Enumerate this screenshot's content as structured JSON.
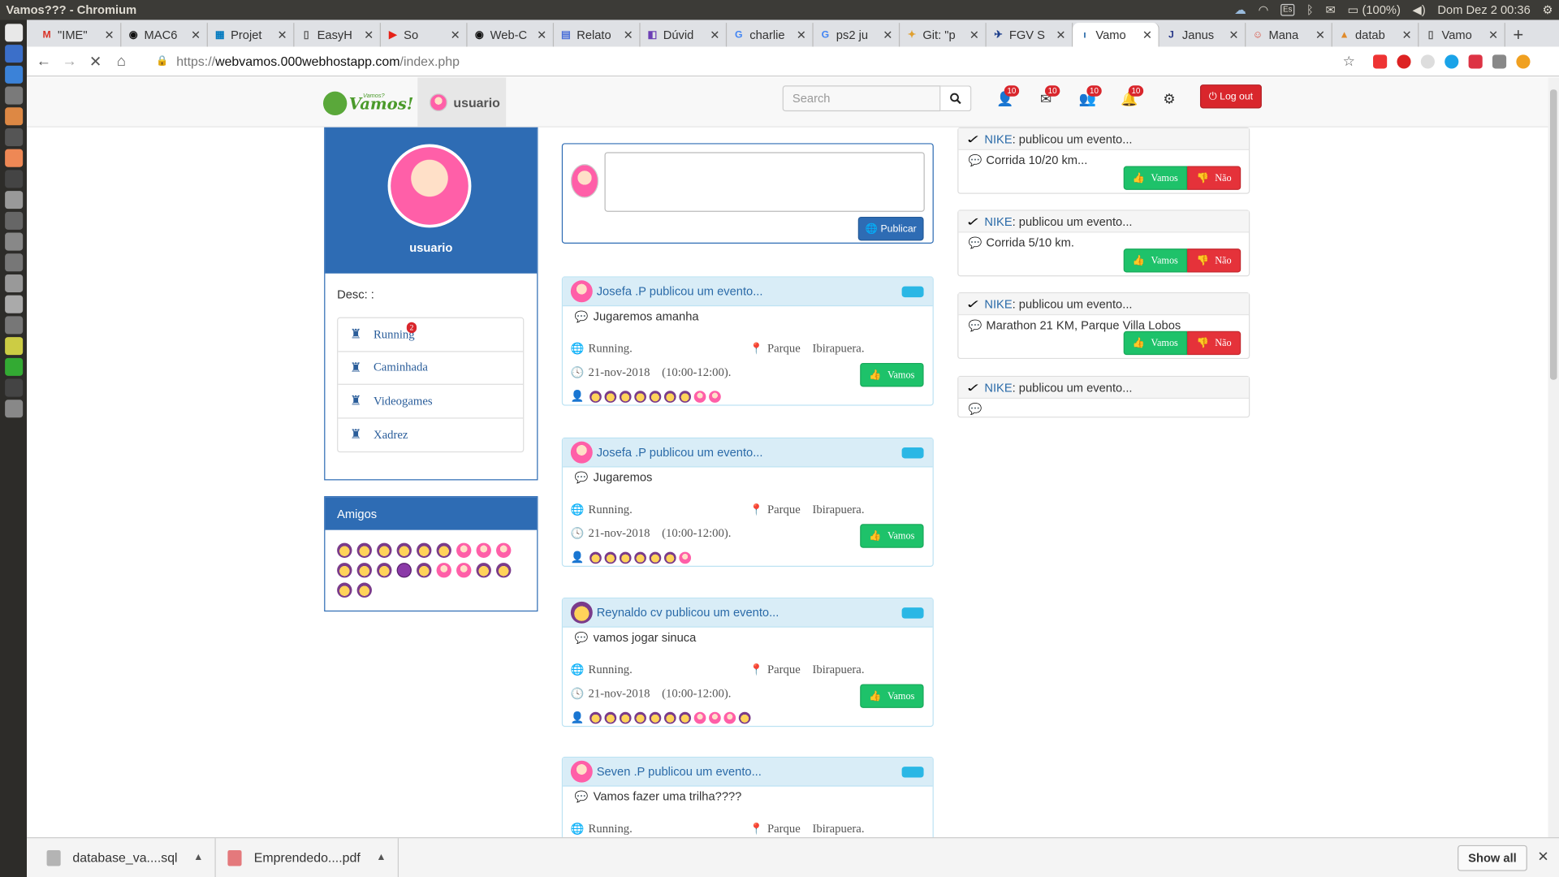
{
  "window": {
    "title": "Vamos??? - Chromium"
  },
  "system_tray": {
    "keyboard": "Es",
    "battery": "(100%)",
    "clock": "Dom Dez  2 00:36"
  },
  "tabs": [
    {
      "label": "\"IME\"",
      "favicon": "M",
      "color": "#d93025"
    },
    {
      "label": "MAC6",
      "favicon": "◉",
      "color": "#111"
    },
    {
      "label": "Projet",
      "favicon": "▦",
      "color": "#0079bf"
    },
    {
      "label": "EasyH",
      "favicon": "▯",
      "color": "#555"
    },
    {
      "label": "So",
      "favicon": "▶",
      "color": "#e62117"
    },
    {
      "label": "Web-C",
      "favicon": "◉",
      "color": "#111"
    },
    {
      "label": "Relato",
      "favicon": "▤",
      "color": "#4a6fd8"
    },
    {
      "label": "Dúvid",
      "favicon": "◧",
      "color": "#6c3fb5"
    },
    {
      "label": "charlie",
      "favicon": "G",
      "color": "#4285f4"
    },
    {
      "label": "ps2 ju",
      "favicon": "G",
      "color": "#4285f4"
    },
    {
      "label": "Git: \"p",
      "favicon": "✦",
      "color": "#e0a030"
    },
    {
      "label": "FGV S",
      "favicon": "✈",
      "color": "#1a3c8a"
    },
    {
      "label": "Vamo",
      "favicon": "ı",
      "color": "#2a6aa8"
    },
    {
      "label": "Janus",
      "favicon": "J",
      "color": "#2a3a8a"
    },
    {
      "label": "Mana",
      "favicon": "☺",
      "color": "#d94a3a"
    },
    {
      "label": "datab",
      "favicon": "▲",
      "color": "#e08a2a"
    },
    {
      "label": "Vamo",
      "favicon": "▯",
      "color": "#555"
    }
  ],
  "active_tab_index": 12,
  "address": {
    "scheme": "https://",
    "host": "webvamos.000webhostapp.com",
    "path": "/index.php"
  },
  "site": {
    "logo_small": "Vamos?",
    "logo_text": "Vamos!",
    "username": "usuario",
    "search_placeholder": "Search",
    "notification_badges": [
      "10",
      "10",
      "10",
      "10"
    ],
    "logout_label": "Log out"
  },
  "profile": {
    "name": "usuario",
    "desc": "Desc: :",
    "hobbies": [
      {
        "label": "Running",
        "badge": "2"
      },
      {
        "label": "Caminhada",
        "badge": ""
      },
      {
        "label": "Videogames",
        "badge": ""
      },
      {
        "label": "Xadrez",
        "badge": ""
      }
    ]
  },
  "friends": {
    "title": "Amigos",
    "avatars": [
      "yellow",
      "yellow",
      "yellow",
      "yellow",
      "yellow",
      "yellow",
      "pink",
      "pink",
      "pink",
      "yellow",
      "yellow",
      "yellow",
      "purple",
      "yellow",
      "pink",
      "pink",
      "yellow",
      "yellow",
      "yellow",
      "yellow"
    ]
  },
  "composer": {
    "publish_label": "Publicar"
  },
  "posts": [
    {
      "author": "Josefa .P publicou um evento...",
      "author_avatar": "pink",
      "text": "Jugaremos amanha",
      "sport": "Running.",
      "place": "Parque    Ibirapuera.",
      "datetime": "21-nov-2018    (10:00-12:00).",
      "button": "Vamos",
      "attendees": [
        "yellow",
        "yellow",
        "yellow",
        "yellow",
        "yellow",
        "yellow",
        "yellow",
        "pink",
        "pink"
      ]
    },
    {
      "author": "Josefa .P publicou um evento...",
      "author_avatar": "pink",
      "text": "Jugaremos",
      "sport": "Running.",
      "place": "Parque    Ibirapuera.",
      "datetime": "21-nov-2018    (10:00-12:00).",
      "button": "Vamos",
      "attendees": [
        "yellow",
        "yellow",
        "yellow",
        "yellow",
        "yellow",
        "yellow",
        "pink"
      ]
    },
    {
      "author": "Reynaldo cv publicou um evento...",
      "author_avatar": "yellow",
      "text": "vamos jogar sinuca",
      "sport": "Running.",
      "place": "Parque    Ibirapuera.",
      "datetime": "21-nov-2018    (10:00-12:00).",
      "button": "Vamos",
      "attendees": [
        "yellow",
        "yellow",
        "yellow",
        "yellow",
        "yellow",
        "yellow",
        "yellow",
        "pink",
        "pink",
        "pink",
        "yellow"
      ]
    },
    {
      "author": "Seven .P publicou um evento...",
      "author_avatar": "pink",
      "text": "Vamos fazer uma trilha????",
      "sport": "Running.",
      "place": "Parque    Ibirapuera.",
      "datetime": "",
      "button": "",
      "attendees": []
    }
  ],
  "sponsored": [
    {
      "brand": "NIKE",
      "headline": " : publicou um evento...",
      "text": "Corrida 10/20 km...",
      "yes": "Vamos",
      "no": "Não"
    },
    {
      "brand": "NIKE",
      "headline": " : publicou um evento...",
      "text": "Corrida 5/10 km.",
      "yes": "Vamos",
      "no": "Não"
    },
    {
      "brand": "NIKE",
      "headline": " : publicou um evento...",
      "text": "Marathon 21 KM, Parque Villa Lobos",
      "yes": "Vamos",
      "no": "Não"
    },
    {
      "brand": "NIKE",
      "headline": " : publicou um evento...",
      "text": "",
      "yes": "",
      "no": ""
    }
  ],
  "downloads": [
    {
      "name": "database_va....sql",
      "color": "#888"
    },
    {
      "name": "Emprendedo....pdf",
      "color": "#d9262c"
    }
  ],
  "download_bar": {
    "show_all": "Show all"
  },
  "colors": {
    "brand_blue": "#2e6cb4",
    "vamos_green": "#1ec26a",
    "nao_red": "#e5323a",
    "logout_red": "#d9262c"
  }
}
